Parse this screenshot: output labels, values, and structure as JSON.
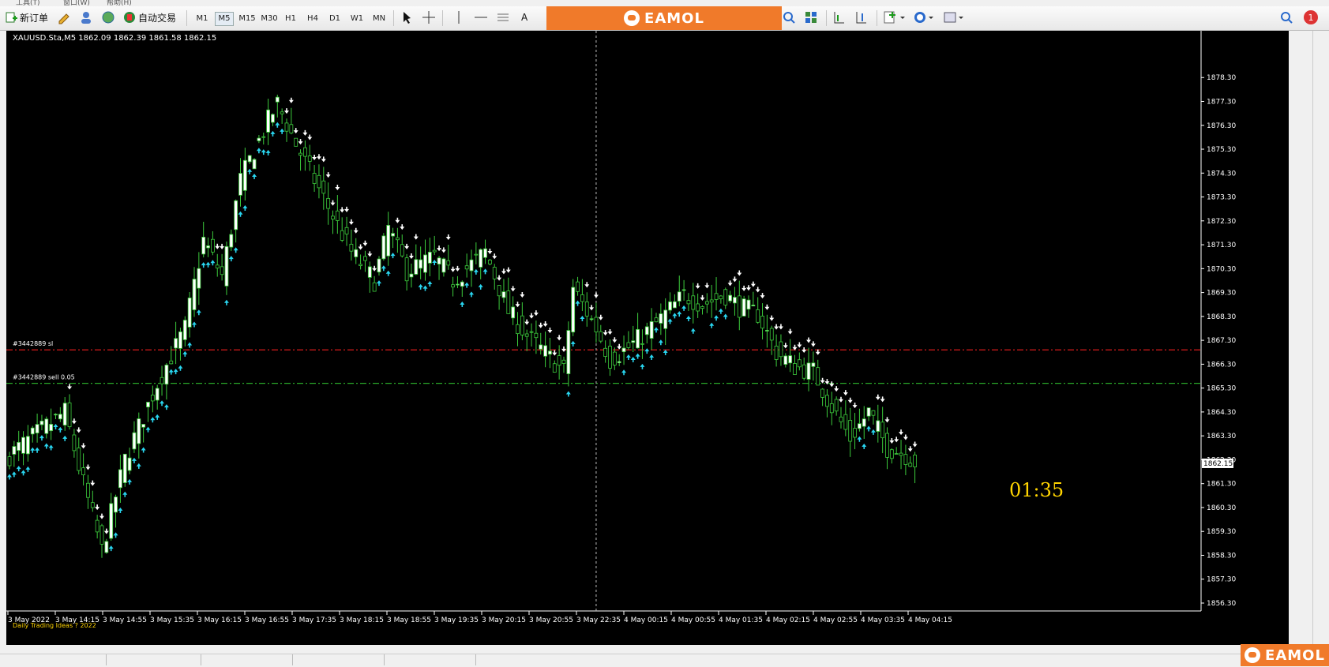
{
  "menubar": {
    "items": [
      "工具(T)",
      "窗口(W)",
      "帮助(H)"
    ]
  },
  "toolbar": {
    "new_order": "新订单",
    "auto_trading": "自动交易",
    "timeframes": [
      "M1",
      "M5",
      "M15",
      "M30",
      "H1",
      "H4",
      "D1",
      "W1",
      "MN"
    ],
    "active_timeframe": "M5",
    "text_tool": "A",
    "notification_count": "1"
  },
  "brand": {
    "name": "EAMOL"
  },
  "chart_data": {
    "type": "candlestick",
    "title": "XAUUSD.Sta,M5  1862.09 1862.39 1861.58 1862.15",
    "ylim": [
      1856.3,
      1879.0
    ],
    "y_ticks": [
      "1878.30",
      "1877.30",
      "1876.30",
      "1875.30",
      "1874.30",
      "1873.30",
      "1872.30",
      "1871.30",
      "1870.30",
      "1869.30",
      "1868.30",
      "1867.30",
      "1866.30",
      "1865.30",
      "1864.30",
      "1863.30",
      "1862.30",
      "1861.30",
      "1860.30",
      "1859.30",
      "1858.30",
      "1857.30",
      "1856.30"
    ],
    "current_price": "1862.15",
    "x_ticks": [
      "3 May 2022",
      "3 May 14:15",
      "3 May 14:55",
      "3 May 15:35",
      "3 May 16:15",
      "3 May 16:55",
      "3 May 17:35",
      "3 May 18:15",
      "3 May 18:55",
      "3 May 19:35",
      "3 May 20:15",
      "3 May 20:55",
      "3 May 22:35",
      "4 May 00:15",
      "4 May 00:55",
      "4 May 01:35",
      "4 May 02:15",
      "4 May 02:55",
      "4 May 03:35",
      "4 May 04:15"
    ],
    "keypoints": [
      [
        0,
        1862.5
      ],
      [
        12,
        1864.3
      ],
      [
        15,
        1862.0
      ],
      [
        20,
        1858.5
      ],
      [
        25,
        1862.3
      ],
      [
        32,
        1865.5
      ],
      [
        38,
        1867.8
      ],
      [
        42,
        1871.5
      ],
      [
        46,
        1870.0
      ],
      [
        50,
        1874.0
      ],
      [
        56,
        1876.5
      ],
      [
        58,
        1877.2
      ],
      [
        62,
        1875.5
      ],
      [
        66,
        1874.0
      ],
      [
        70,
        1872.5
      ],
      [
        74,
        1871.0
      ],
      [
        79,
        1869.8
      ],
      [
        82,
        1872.0
      ],
      [
        86,
        1870.2
      ],
      [
        92,
        1870.8
      ],
      [
        96,
        1869.8
      ],
      [
        103,
        1871.0
      ],
      [
        108,
        1868.5
      ],
      [
        112,
        1867.5
      ],
      [
        120,
        1866.0
      ],
      [
        122,
        1869.5
      ],
      [
        127,
        1867.8
      ],
      [
        130,
        1866.5
      ],
      [
        134,
        1867.0
      ],
      [
        140,
        1868.0
      ],
      [
        146,
        1869.2
      ],
      [
        150,
        1868.8
      ],
      [
        155,
        1869.2
      ],
      [
        158,
        1868.7
      ],
      [
        162,
        1868.4
      ],
      [
        166,
        1866.8
      ],
      [
        170,
        1866.2
      ],
      [
        174,
        1866.0
      ],
      [
        178,
        1864.5
      ],
      [
        182,
        1863.2
      ],
      [
        186,
        1864.3
      ],
      [
        190,
        1862.8
      ],
      [
        194,
        1862.5
      ],
      [
        196,
        1862.2
      ]
    ],
    "orders": [
      {
        "label": "#3442889 sl",
        "price": 1866.9
      },
      {
        "label": "#3442889 sell 0.05",
        "price": 1865.5
      }
    ],
    "crosshair_index": 127,
    "countdown": "01:35",
    "watermark": "Daily Trading Ideas  ? 2022"
  }
}
